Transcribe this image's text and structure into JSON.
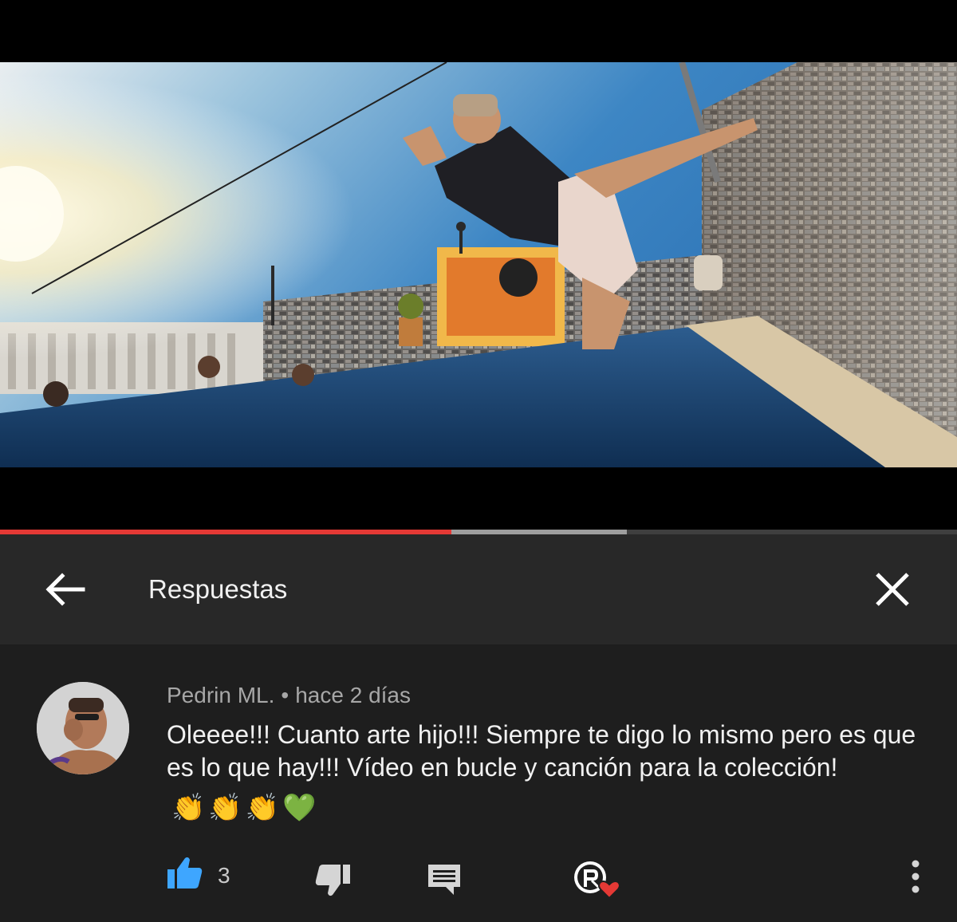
{
  "player": {
    "progress_played": 0.472,
    "progress_buffered": 0.655
  },
  "header": {
    "title": "Respuestas",
    "back_icon": "arrow-back-icon",
    "close_icon": "close-icon"
  },
  "comment": {
    "author": "Pedrin ML.",
    "separator": "•",
    "time": "hace 2 días",
    "text": "Oleeee!!! Cuanto arte hijo!!! Siempre te digo lo mismo pero es que es lo que hay!!! Vídeo en bucle y canción para la colección!",
    "emojis": [
      "👏",
      "👏",
      "👏",
      "💚"
    ],
    "likes": "3"
  },
  "colors": {
    "accent_red": "#e53935",
    "like_blue": "#3ea6ff",
    "header_bg": "#282828",
    "comment_bg": "#1e1e1e"
  }
}
